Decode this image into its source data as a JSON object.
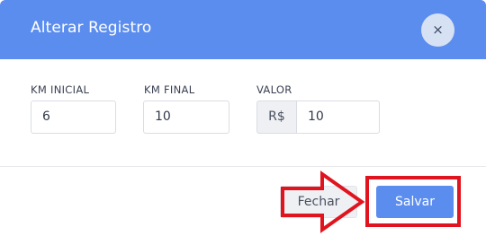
{
  "dialog": {
    "title": "Alterar Registro",
    "close_icon": "×"
  },
  "fields": {
    "km_inicial": {
      "label": "KM INICIAL",
      "value": "6"
    },
    "km_final": {
      "label": "KM FINAL",
      "value": "10"
    },
    "valor": {
      "label": "VALOR",
      "prefix": "R$",
      "value": "10"
    }
  },
  "footer": {
    "close_label": "Fechar",
    "save_label": "Salvar"
  },
  "colors": {
    "header": "#5b8def",
    "primary_button": "#5b8def",
    "annotation": "#e0141e"
  }
}
